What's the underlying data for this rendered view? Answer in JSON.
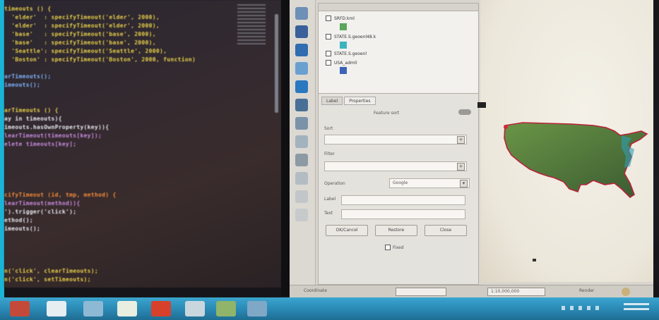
{
  "editor": {
    "lines": [
      {
        "text": "timeouts () {",
        "cls": "c-y"
      },
      {
        "text": "  'elder'  : specifyTimeout('elder', 2000),",
        "cls": "c-y"
      },
      {
        "text": "  'elder'  : specifyTimeout('elder', 2000),",
        "cls": "c-y"
      },
      {
        "text": "  'base'   : specifyTimeout('base', 2000),",
        "cls": "c-y"
      },
      {
        "text": "  'base'   : specifyTimeout('base', 2000),",
        "cls": "c-y"
      },
      {
        "text": "  'Seattle': specifyTimeout('Seattle', 2000),",
        "cls": "c-y"
      },
      {
        "text": "  'Boston' : specifyTimeout('Boston', 2000, function)",
        "cls": "c-y"
      },
      {
        "text": "",
        "cls": "c-w"
      },
      {
        "text": "arTimeouts();",
        "cls": "c-b"
      },
      {
        "text": "imeouts();",
        "cls": "c-b"
      },
      {
        "text": "",
        "cls": "c-w"
      },
      {
        "text": "",
        "cls": "c-w"
      },
      {
        "text": "arTimeouts () {",
        "cls": "c-y"
      },
      {
        "text": "ay in timeouts){",
        "cls": "c-w"
      },
      {
        "text": "imeouts.hasOwnProperty(key)){",
        "cls": "c-w"
      },
      {
        "text": "learTimeout(timeouts[key]);",
        "cls": "c-p"
      },
      {
        "text": "elete timeouts[key];",
        "cls": "c-p"
      },
      {
        "text": "",
        "cls": "c-w"
      },
      {
        "text": "",
        "cls": "c-w"
      },
      {
        "text": "",
        "cls": "c-w"
      },
      {
        "text": "",
        "cls": "c-w"
      },
      {
        "text": "",
        "cls": "c-w"
      },
      {
        "text": "cifyTimeout (id, tmp, method) {",
        "cls": "c-o"
      },
      {
        "text": "learTimeout(method)){",
        "cls": "c-p"
      },
      {
        "text": "').trigger('click');",
        "cls": "c-w"
      },
      {
        "text": "ethod();",
        "cls": "c-w"
      },
      {
        "text": "imeouts();",
        "cls": "c-w"
      },
      {
        "text": "",
        "cls": "c-w"
      },
      {
        "text": "",
        "cls": "c-w"
      },
      {
        "text": "",
        "cls": "c-w"
      },
      {
        "text": "",
        "cls": "c-w"
      },
      {
        "text": "n('click', clearTimeouts);",
        "cls": "c-y"
      },
      {
        "text": "n('click', setTimeouts);",
        "cls": "c-y"
      }
    ]
  },
  "qgis": {
    "layers": [
      {
        "name": "SRFD.kml"
      },
      {
        "name": "STATE.S.geoenl48.k"
      },
      {
        "name": "STATE.S.geoenl"
      },
      {
        "name": "USA_adm0"
      }
    ],
    "props": {
      "tabs": [
        "Label",
        "Properties"
      ],
      "section": "Feature sort",
      "field1_label": "Sort",
      "field2_label": "Filter",
      "param_label": "Operation",
      "param_value": "Google",
      "label_a": "Label",
      "label_b": "Text",
      "buttons": [
        "OK/Cancel",
        "Restore",
        "Close"
      ],
      "check_label": "Fixed"
    },
    "status": {
      "coord": "Coordinate",
      "scale": "1:10,000,000",
      "render": "Render"
    }
  },
  "colors": {
    "map_fill_top": "#5f8a3f",
    "map_fill_bottom": "#3c5a2f",
    "map_border": "#b8223a",
    "taskbar": "#2b8ab6"
  }
}
